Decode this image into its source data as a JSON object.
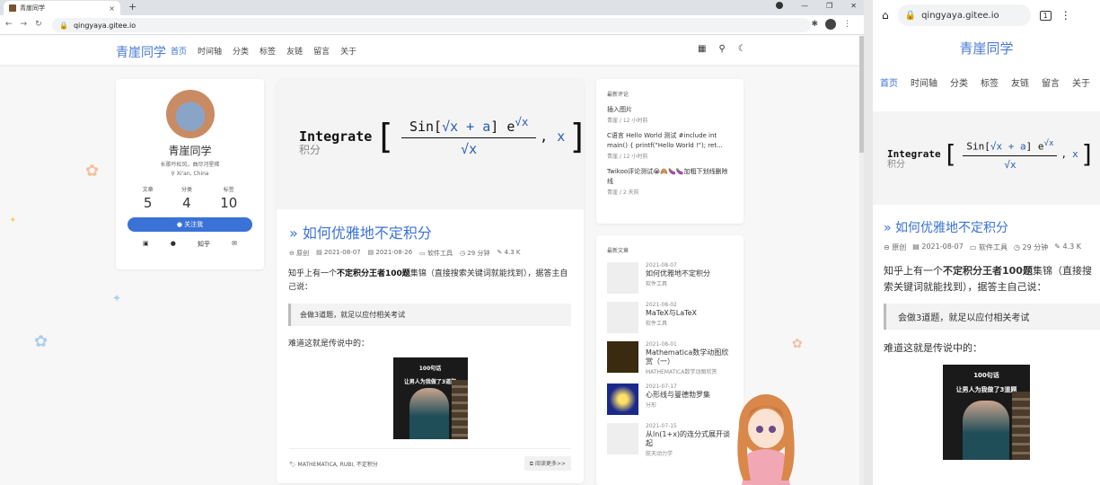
{
  "browser": {
    "tab_title": "青崖同学",
    "tab_close": "×",
    "new_tab": "+",
    "url": "qingyaya.gitee.io"
  },
  "site": {
    "brand": "青崖同学",
    "menu": [
      "首页",
      "时间轴",
      "分类",
      "标签",
      "友链",
      "留言",
      "关于"
    ]
  },
  "profile": {
    "name": "青崖同学",
    "desc": "长歌吟松风，曲尽河星稀",
    "location": "Xi'an, China",
    "stats": [
      {
        "label": "文章",
        "value": "5"
      },
      {
        "label": "分类",
        "value": "4"
      },
      {
        "label": "标签",
        "value": "10"
      }
    ],
    "follow": "关注我",
    "social_zhihu": "知乎"
  },
  "post": {
    "formula_word": "Integrate",
    "formula_zh": "积分",
    "formula_numerator": "Sin",
    "formula_sqrt_x": "√x",
    "formula_plus_a": "+ a",
    "formula_exp": "e",
    "formula_exp_sup": "√x",
    "formula_comma": ",",
    "formula_var": "x",
    "title": "如何优雅地不定积分",
    "meta": {
      "type": "原创",
      "created": "2021-08-07",
      "updated": "2021-08-26",
      "category": "软件工具",
      "reading_time": "29 分钟",
      "words": "4.3 K"
    },
    "para1_a": "知乎上有一个",
    "para1_b": "不定积分王者100题",
    "para1_c": "集锦（直接搜索关键词就能找到），据答主自己说：",
    "quote": "会做3道题，就足以应付相关考试",
    "para2": "难道这就是传说中的：",
    "image_caption1": "100句话",
    "image_caption2": "让男人为我做了3道题",
    "tags": "MATHEMATICA, RUBI, 不定积分",
    "read_more": "阅读更多>>"
  },
  "comments": {
    "heading": "最新评论",
    "items": [
      {
        "text": "插入图片",
        "meta": "青崖 / 12 小时前"
      },
      {
        "text": "C语言 Hello World 测试 #include int main() { printf(\"Hello World !\"); ret...",
        "meta": "青崖 / 12 小时前"
      },
      {
        "text": "Twikoo评论测试😭🙈🍆🍆加粗下划线删除线",
        "meta": "青崖 / 2 天前"
      }
    ]
  },
  "recent": {
    "heading": "最新文章",
    "items": [
      {
        "date": "2021-08-07",
        "title": "如何优雅地不定积分",
        "category": "软件工具"
      },
      {
        "date": "2021-08-02",
        "title": "MaTeX与LaTeX",
        "category": "软件工具"
      },
      {
        "date": "2021-08-01",
        "title": "Mathematica数学动图欣赏（一）",
        "category": "MATHEMATICA数学动图欣赏"
      },
      {
        "date": "2021-07-17",
        "title": "心形线与曼德勃罗集",
        "category": "分形"
      },
      {
        "date": "2021-07-15",
        "title": "从ln(1+x)的连分式展开谈起",
        "category": "航天动力学"
      }
    ]
  },
  "mobile": {
    "url": "qingyaya.gitee.io",
    "tab_count": "1",
    "post_meta": {
      "type": "原创",
      "date": "2021-08-07",
      "category": "软件工具",
      "reading_time": "29 分钟",
      "words": "4.3 K"
    }
  },
  "colors": {
    "accent": "#3a72d6",
    "brand": "#4a7bd1"
  }
}
